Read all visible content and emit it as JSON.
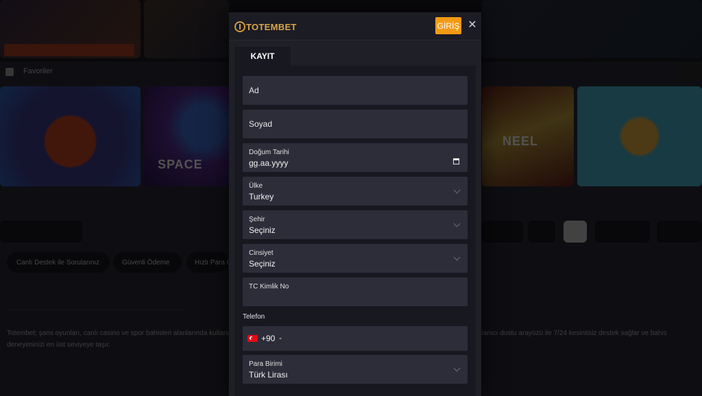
{
  "background": {
    "nav_text": "Favoriler",
    "card_captions": [
      "SPACE",
      "NEEL"
    ],
    "chips": [
      "Canlı Destek ile Sorularınız",
      "Güvenli Ödeme",
      "Hızlı Para Çekme"
    ],
    "paragraph": "Totembet; şans oyunları, canlı casino ve spor bahisleri alanlarında kullanıcılarına güvenilir bir oyun ortamı sunar. Lisanslı altyapısı, hızlı işlem süreçleri ve kullanıcı dostu arayüzü ile 7/24 kesintisiz destek sağlar ve bahis deneyiminizi en üst seviyeye taşır."
  },
  "modal": {
    "logo_text": "TOTEMBET",
    "login_label": "GİRİŞ",
    "close_glyph": "✕",
    "tab_label": "KAYIT",
    "fields": {
      "first_name_placeholder": "Ad",
      "last_name_placeholder": "Soyad",
      "birthdate_label": "Doğum Tarihi",
      "birthdate_value": "gg.aa.yyyy",
      "country_label": "Ülke",
      "country_value": "Turkey",
      "city_label": "Şehir",
      "city_value": "Seçiniz",
      "gender_label": "Cinsiyet",
      "gender_value": "Seçiniz",
      "tc_label": "TC Kimlik No",
      "tc_value": "",
      "phone_section_label": "Telefon",
      "phone_dial_code": "+90",
      "currency_label": "Para Birimi",
      "currency_value": "Türk Lirası"
    },
    "icons": {
      "calendar": "calendar-icon",
      "chevron": "chevron-down-icon",
      "flag": "turkey-flag-icon"
    },
    "colors": {
      "accent": "#f39a14",
      "field_bg": "#2d2d3a",
      "modal_bg": "#1f1f27"
    }
  }
}
